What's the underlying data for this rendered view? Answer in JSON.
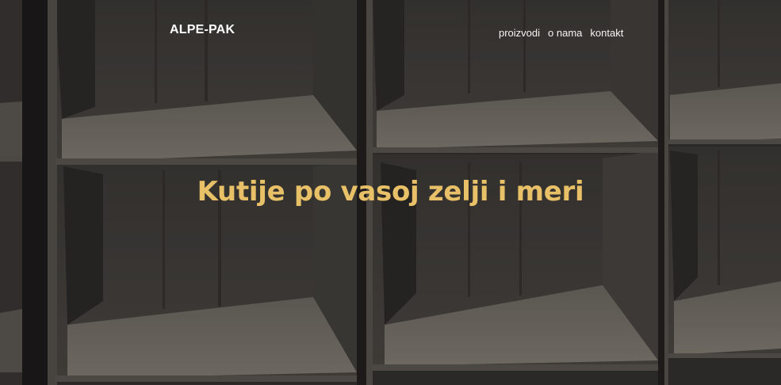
{
  "header": {
    "brand": "ALPE-PAK",
    "nav": [
      {
        "label": "proizvodi"
      },
      {
        "label": "o nama"
      },
      {
        "label": "kontakt"
      }
    ]
  },
  "hero": {
    "headline": "Kutije po vasoj zelji i meri",
    "background_image": "cardboard-boxes-shelves",
    "accent_color": "#e8c067"
  }
}
